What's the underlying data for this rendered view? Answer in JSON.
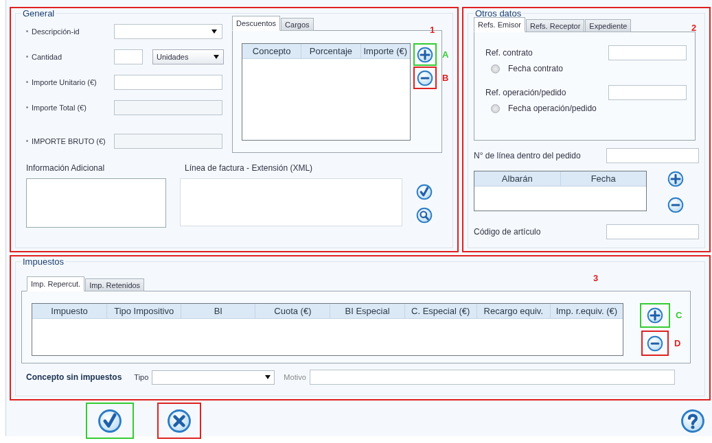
{
  "general": {
    "title": "General",
    "marker": "1",
    "fields": [
      {
        "kind": "combo",
        "label": "Descripción-id"
      },
      {
        "kind": "quantity",
        "label": "Cantidad",
        "unit": "Unidades"
      },
      {
        "kind": "text",
        "label": "Importe Unitario (€)"
      },
      {
        "kind": "readonly",
        "label": "Importe Total (€)"
      },
      {
        "kind": "readonly",
        "label": "IMPORTE BRUTO (€)"
      }
    ],
    "tabs": [
      {
        "label": "Descuentos",
        "selected": true
      },
      {
        "label": "Cargos",
        "selected": false
      }
    ],
    "table": {
      "columns": [
        "Concepto",
        "Porcentaje",
        "Importe (€)"
      ]
    },
    "buttons": [
      {
        "kind": "add",
        "callout": "A",
        "color": "#33cc33"
      },
      {
        "kind": "remove",
        "callout": "B",
        "color": "#dd2222"
      }
    ],
    "info_label": "Información Adicional",
    "xml_label": "Línea de factura - Extensión (XML)",
    "xml_buttons": [
      {
        "kind": "accept"
      },
      {
        "kind": "search"
      }
    ]
  },
  "otros": {
    "title": "Otros datos",
    "marker": "2",
    "tabs": [
      {
        "label": "Refs. Emisor",
        "selected": true
      },
      {
        "label": "Refs. Receptor",
        "selected": false
      },
      {
        "label": "Expediente",
        "selected": false
      }
    ],
    "refs": [
      {
        "label": "Ref. contrato",
        "radio": "Fecha contrato",
        "selected": false
      },
      {
        "label": "Ref. operación/pedido",
        "radio": "Fecha operación/pedido",
        "selected": false
      }
    ],
    "line_label": "N° de línea dentro del pedido",
    "table": {
      "columns": [
        "Albarán",
        "Fecha"
      ]
    },
    "buttons": [
      {
        "kind": "add"
      },
      {
        "kind": "remove"
      }
    ],
    "code_label": "Código de artículo"
  },
  "impuestos": {
    "title": "Impuestos",
    "marker": "3",
    "tabs": [
      {
        "label": "Imp. Repercut.",
        "selected": true
      },
      {
        "label": "Imp. Retenidos",
        "selected": false
      }
    ],
    "table": {
      "columns": [
        "Impuesto",
        "Tipo Impositivo",
        "BI",
        "Cuota (€)",
        "BI Especial",
        "C. Especial (€)",
        "Recargo equiv.",
        "Imp. r.equiv. (€)"
      ]
    },
    "buttons": [
      {
        "kind": "add",
        "callout": "C",
        "color": "#33cc33"
      },
      {
        "kind": "remove",
        "callout": "D",
        "color": "#dd2222"
      }
    ],
    "no_tax_label": "Concepto sin impuestos",
    "type_label": "Tipo",
    "reason_label": "Motivo"
  },
  "footer": {
    "buttons": [
      {
        "kind": "accept",
        "color": "#33cc33"
      },
      {
        "kind": "cancel",
        "color": "#dd2222"
      },
      {
        "kind": "help"
      }
    ]
  }
}
